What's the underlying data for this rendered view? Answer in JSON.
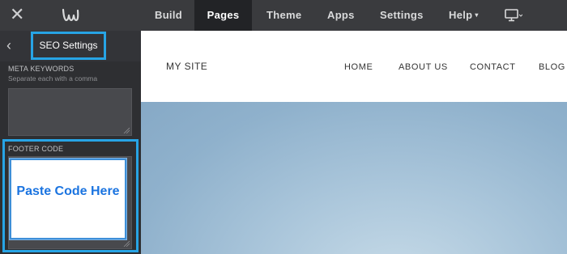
{
  "topbar": {
    "nav": [
      {
        "label": "Build"
      },
      {
        "label": "Pages",
        "active": true
      },
      {
        "label": "Theme"
      },
      {
        "label": "Apps"
      },
      {
        "label": "Settings"
      },
      {
        "label": "Help"
      }
    ],
    "icons": [
      "close-icon",
      "weebly-logo-icon",
      "desktop-device-icon"
    ]
  },
  "sidebar": {
    "title": "SEO Settings",
    "meta_keywords": {
      "label": "META KEYWORDS",
      "hint": "Separate each with a comma",
      "value": ""
    },
    "footer_code": {
      "label": "FOOTER CODE",
      "value": "Paste Code Here"
    }
  },
  "preview": {
    "site_name": "MY SITE",
    "nav": [
      "HOME",
      "ABOUT US",
      "CONTACT",
      "BLOG"
    ]
  },
  "colors": {
    "highlight": "#27a4e5",
    "topbar": "#3a3b3e",
    "sidebar": "#2e2f32",
    "code_text": "#1b74e0"
  }
}
